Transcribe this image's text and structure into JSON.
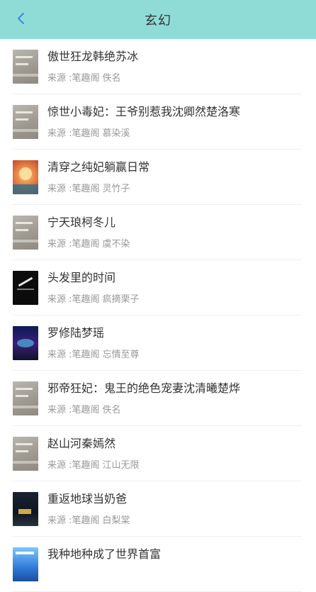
{
  "header": {
    "title": "玄幻",
    "back_icon": "chevron-left-icon",
    "background": "#8fdcd6",
    "back_color": "#3a86e8"
  },
  "meta_prefix": "来源 :",
  "books": [
    {
      "title": "傲世狂龙韩绝苏冰",
      "source": "笔趣阁",
      "author": "佚名",
      "cover": "default"
    },
    {
      "title": "惊世小毒妃：王爷别惹我沈卿然楚洛寒",
      "source": "笔趣阁",
      "author": "慕染溪",
      "cover": "default"
    },
    {
      "title": "清穿之纯妃躺赢日常",
      "source": "笔趣阁",
      "author": "灵竹子",
      "cover": "c-red"
    },
    {
      "title": "宁天琅柯冬儿",
      "source": "笔趣阁",
      "author": "虞不染",
      "cover": "default"
    },
    {
      "title": "头发里的时间",
      "source": "笔趣阁",
      "author": "疯摘栗子",
      "cover": "c-black"
    },
    {
      "title": "罗修陆梦瑶",
      "source": "笔趣阁",
      "author": "忘情至尊",
      "cover": "c-galaxy"
    },
    {
      "title": "邪帝狂妃：鬼王的绝色宠妻沈清曦楚烨",
      "source": "笔趣阁",
      "author": "佚名",
      "cover": "default"
    },
    {
      "title": "赵山河秦嫣然",
      "source": "笔趣阁",
      "author": "江山无限",
      "cover": "default"
    },
    {
      "title": "重返地球当奶爸",
      "source": "笔趣阁",
      "author": "白梨棠",
      "cover": "c-dark"
    },
    {
      "title": "我种地种成了世界首富",
      "source": "",
      "author": "",
      "cover": "c-blue"
    }
  ]
}
